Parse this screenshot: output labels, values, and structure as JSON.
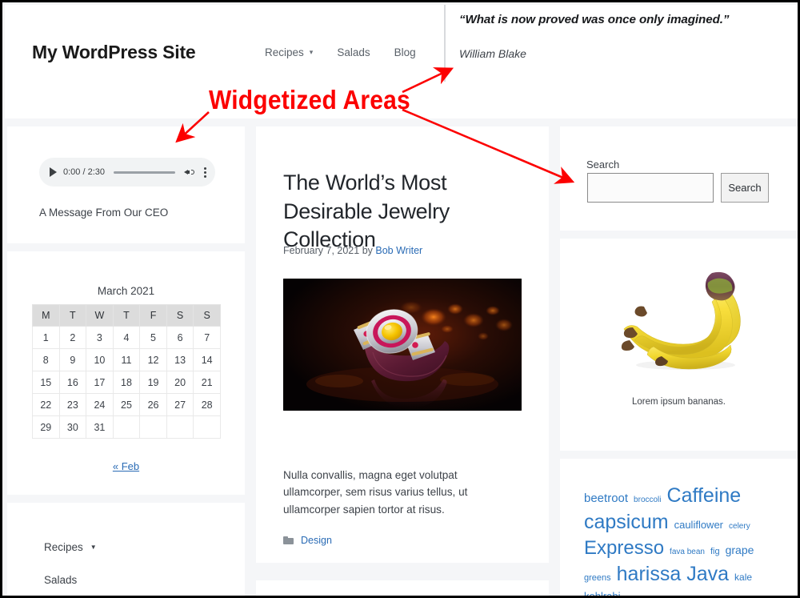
{
  "header": {
    "site_title": "My WordPress Site",
    "nav": [
      {
        "label": "Recipes",
        "has_submenu": true,
        "icon": "chevron-down-icon"
      },
      {
        "label": "Salads",
        "has_submenu": false
      },
      {
        "label": "Blog",
        "has_submenu": false
      }
    ],
    "quote": "“What is now proved was once only imagined.”",
    "cite": "William Blake"
  },
  "annotation": {
    "label": "Widgetized Areas",
    "color": "#fc0000"
  },
  "left_sidebar": {
    "audio_widget": {
      "play_icon": "play-icon",
      "time": "0:00 / 2:30",
      "volume_icon": "volume-icon",
      "overflow_icon": "more-vertical-icon",
      "caption": "A Message From Our CEO"
    },
    "calendar_widget": {
      "title": "March 2021",
      "day_headers": [
        "M",
        "T",
        "W",
        "T",
        "F",
        "S",
        "S"
      ],
      "weeks": [
        [
          "1",
          "2",
          "3",
          "4",
          "5",
          "6",
          "7"
        ],
        [
          "8",
          "9",
          "10",
          "11",
          "12",
          "13",
          "14"
        ],
        [
          "15",
          "16",
          "17",
          "18",
          "19",
          "20",
          "21"
        ],
        [
          "22",
          "23",
          "24",
          "25",
          "26",
          "27",
          "28"
        ],
        [
          "29",
          "30",
          "31",
          "",
          "",
          "",
          ""
        ]
      ],
      "prev_link": "« Feb"
    },
    "menu_widget": {
      "items": [
        {
          "label": "Recipes",
          "has_submenu": true,
          "icon": "caret-down-icon"
        },
        {
          "label": "Salads",
          "has_submenu": false
        }
      ]
    }
  },
  "main": {
    "post": {
      "title": "The World’s Most Desirable Jewelry Collection",
      "date": "February 7, 2021",
      "by_word": "by",
      "author": "Bob Writer",
      "image_alt": "jewelry-bracelet-photo",
      "excerpt": "Nulla convallis, magna eget volutpat ullamcorper, sem risus varius tellus, ut ullamcorper sapien tortor at risus.",
      "category_icon": "folder-icon",
      "category": "Design"
    }
  },
  "right_sidebar": {
    "search_widget": {
      "label": "Search",
      "value": "",
      "placeholder": "",
      "button_label": "Search"
    },
    "image_widget": {
      "image_alt": "bananas-photo",
      "caption": "Lorem ipsum bananas."
    },
    "tag_cloud": {
      "tags": [
        {
          "label": "beetroot",
          "size": 15
        },
        {
          "label": "broccoli",
          "size": 10
        },
        {
          "label": "Caffeine",
          "size": 25
        },
        {
          "label": "capsicum",
          "size": 25
        },
        {
          "label": "cauliflower",
          "size": 13
        },
        {
          "label": "celery",
          "size": 10
        },
        {
          "label": "Expresso",
          "size": 24
        },
        {
          "label": "fava bean",
          "size": 10
        },
        {
          "label": "fig",
          "size": 11
        },
        {
          "label": "grape",
          "size": 14
        },
        {
          "label": "greens",
          "size": 11
        },
        {
          "label": "harissa",
          "size": 25
        },
        {
          "label": "Java",
          "size": 25
        },
        {
          "label": "kale",
          "size": 12
        },
        {
          "label": "kohlrabi",
          "size": 13
        }
      ],
      "link_color": "#2f7ac4"
    }
  },
  "colors": {
    "page_background": "#f5f6f8",
    "card_background": "#ffffff",
    "link": "#2a6bb5",
    "text": "#3d4249",
    "annotation_red": "#fc0000"
  }
}
